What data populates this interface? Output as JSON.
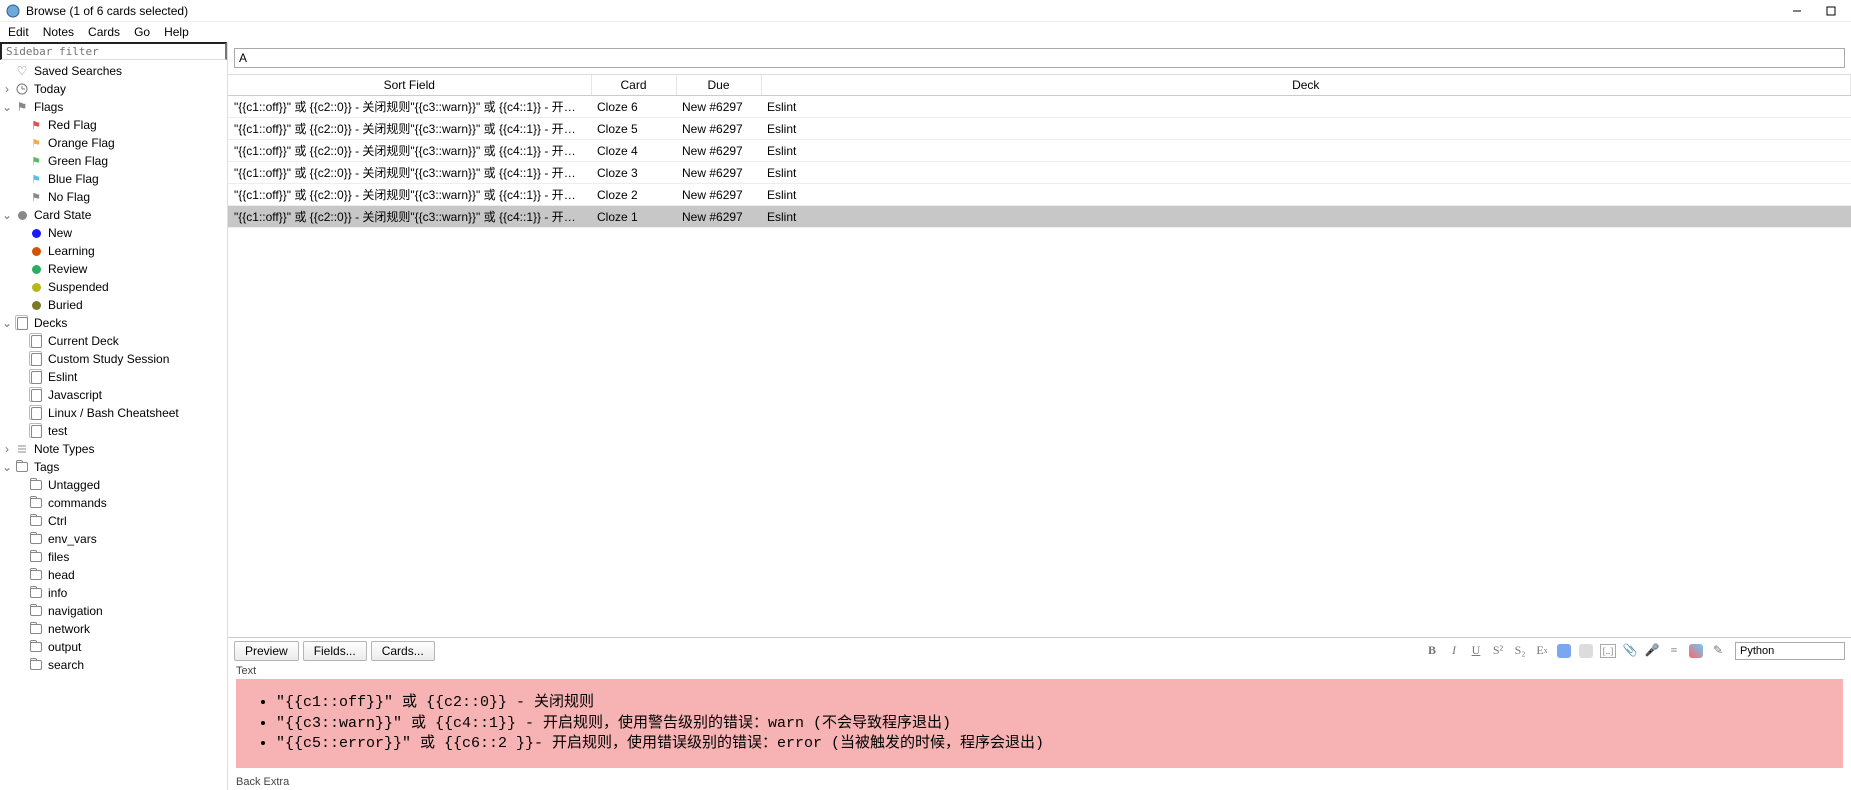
{
  "window": {
    "title": "Browse (1 of 6 cards selected)"
  },
  "menubar": [
    "Edit",
    "Notes",
    "Cards",
    "Go",
    "Help"
  ],
  "sidebar": {
    "filter_placeholder": "Sidebar filter",
    "saved_searches": "Saved Searches",
    "today": "Today",
    "flags": {
      "label": "Flags",
      "items": [
        {
          "label": "Red Flag",
          "color": "#d9534f"
        },
        {
          "label": "Orange Flag",
          "color": "#f0ad4e"
        },
        {
          "label": "Green Flag",
          "color": "#5cb85c"
        },
        {
          "label": "Blue Flag",
          "color": "#5bc0de"
        },
        {
          "label": "No Flag",
          "color": "#888888"
        }
      ]
    },
    "card_state": {
      "label": "Card State",
      "items": [
        {
          "label": "New",
          "color": "#1a1aff"
        },
        {
          "label": "Learning",
          "color": "#d35400"
        },
        {
          "label": "Review",
          "color": "#27ae60"
        },
        {
          "label": "Suspended",
          "color": "#b7b71a"
        },
        {
          "label": "Buried",
          "color": "#7a7a2a"
        }
      ]
    },
    "decks": {
      "label": "Decks",
      "items": [
        "Current Deck",
        "Custom Study Session",
        "Eslint",
        "Javascript",
        "Linux / Bash Cheatsheet",
        "test"
      ]
    },
    "note_types": "Note Types",
    "tags": {
      "label": "Tags",
      "items": [
        "Untagged",
        "commands",
        "Ctrl",
        "env_vars",
        "files",
        "head",
        "info",
        "navigation",
        "network",
        "output",
        "search"
      ]
    }
  },
  "search": {
    "value": "A"
  },
  "table": {
    "headers": {
      "sort_field": "Sort Field",
      "card": "Card",
      "due": "Due",
      "deck": "Deck"
    },
    "rows": [
      {
        "sort_field": "\"{{c1::off}}\" 或 {{c2::0}} - 关闭规则\"{{c3::warn}}\" 或 {{c4::1}} - 开启规则，使...",
        "card": "Cloze 6",
        "due": "New #6297",
        "deck": "Eslint",
        "selected": false
      },
      {
        "sort_field": "\"{{c1::off}}\" 或 {{c2::0}} - 关闭规则\"{{c3::warn}}\" 或 {{c4::1}} - 开启规则，使...",
        "card": "Cloze 5",
        "due": "New #6297",
        "deck": "Eslint",
        "selected": false
      },
      {
        "sort_field": "\"{{c1::off}}\" 或 {{c2::0}} - 关闭规则\"{{c3::warn}}\" 或 {{c4::1}} - 开启规则，使...",
        "card": "Cloze 4",
        "due": "New #6297",
        "deck": "Eslint",
        "selected": false
      },
      {
        "sort_field": "\"{{c1::off}}\" 或 {{c2::0}} - 关闭规则\"{{c3::warn}}\" 或 {{c4::1}} - 开启规则，使...",
        "card": "Cloze 3",
        "due": "New #6297",
        "deck": "Eslint",
        "selected": false
      },
      {
        "sort_field": "\"{{c1::off}}\" 或 {{c2::0}} - 关闭规则\"{{c3::warn}}\" 或 {{c4::1}} - 开启规则，使...",
        "card": "Cloze 2",
        "due": "New #6297",
        "deck": "Eslint",
        "selected": false
      },
      {
        "sort_field": "\"{{c1::off}}\" 或 {{c2::0}} - 关闭规则\"{{c3::warn}}\" 或 {{c4::1}} - 开启规则，使...",
        "card": "Cloze 1",
        "due": "New #6297",
        "deck": "Eslint",
        "selected": true
      }
    ]
  },
  "editor": {
    "buttons": {
      "preview": "Preview",
      "fields": "Fields...",
      "cards": "Cards..."
    },
    "tag_value": "Python",
    "field_text_label": "Text",
    "field_back_label": "Back Extra",
    "lines": [
      "\"{{c1::off}}\" 或 {{c2::0}} - 关闭规则",
      "\"{{c3::warn}}\" 或 {{c4::1}} - 开启规则，使用警告级别的错误：warn (不会导致程序退出)",
      "\"{{c5::error}}\" 或 {{c6::2 }}- 开启规则，使用错误级别的错误：error (当被触发的时候，程序会退出)"
    ]
  }
}
